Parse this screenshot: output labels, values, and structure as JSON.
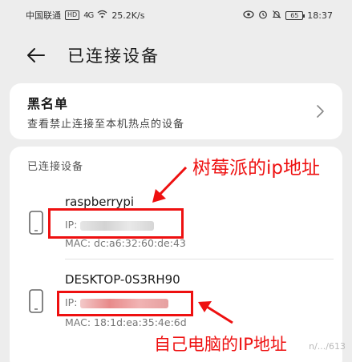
{
  "status_bar": {
    "carrier": "中国联通",
    "hd": "HD",
    "signal": "4G",
    "speed": "25.2K/s",
    "battery": "65",
    "time": "18:37"
  },
  "header": {
    "title": "已连接设备"
  },
  "blacklist": {
    "title": "黑名单",
    "description": "查看禁止连接至本机热点的设备"
  },
  "devices_section": {
    "title": "已连接设备",
    "devices": [
      {
        "name": "raspberrypi",
        "ip_label": "IP:",
        "mac": "MAC: dc:a6:32:60:de:43"
      },
      {
        "name": "DESKTOP-0S3RH90",
        "ip_label": "IP:",
        "mac": "MAC: 18:1d:ea:35:4e:6d"
      }
    ]
  },
  "annotations": {
    "label_1": "树莓派的ip地址",
    "label_2": "自己电脑的IP地址",
    "color": "#ee1010"
  },
  "watermark": "n/.../613"
}
